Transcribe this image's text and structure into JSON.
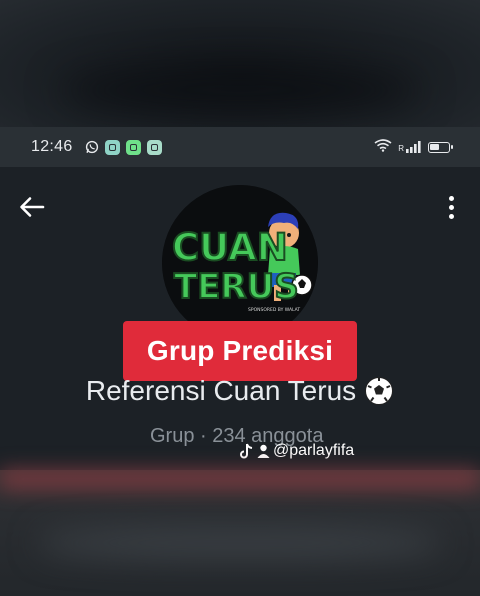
{
  "status_bar": {
    "time": "12:46",
    "icons_left": [
      "whatsapp-icon",
      "app-notification-icon",
      "app-notification-icon",
      "shield-app-icon"
    ],
    "icons_right": [
      "wifi-icon",
      "signal-icon",
      "battery-icon"
    ],
    "signal_label": "R"
  },
  "header": {
    "back_icon": "arrow-left-icon",
    "more_icon": "more-vertical-icon"
  },
  "avatar": {
    "logo_line1": "CUAN",
    "logo_line2": "TERUS",
    "logo_small": "SPONSORED BY WALAT"
  },
  "group": {
    "badge": "Grup Prediksi",
    "name": "Referensi Cuan Terus",
    "meta": "Grup · 234 anggota"
  },
  "watermark": {
    "handle": "@parlayfifa"
  },
  "colors": {
    "badge": "#e02b3a",
    "logo_green": "#45c95a",
    "background": "#1c2126",
    "status_bar": "#2a3035"
  }
}
